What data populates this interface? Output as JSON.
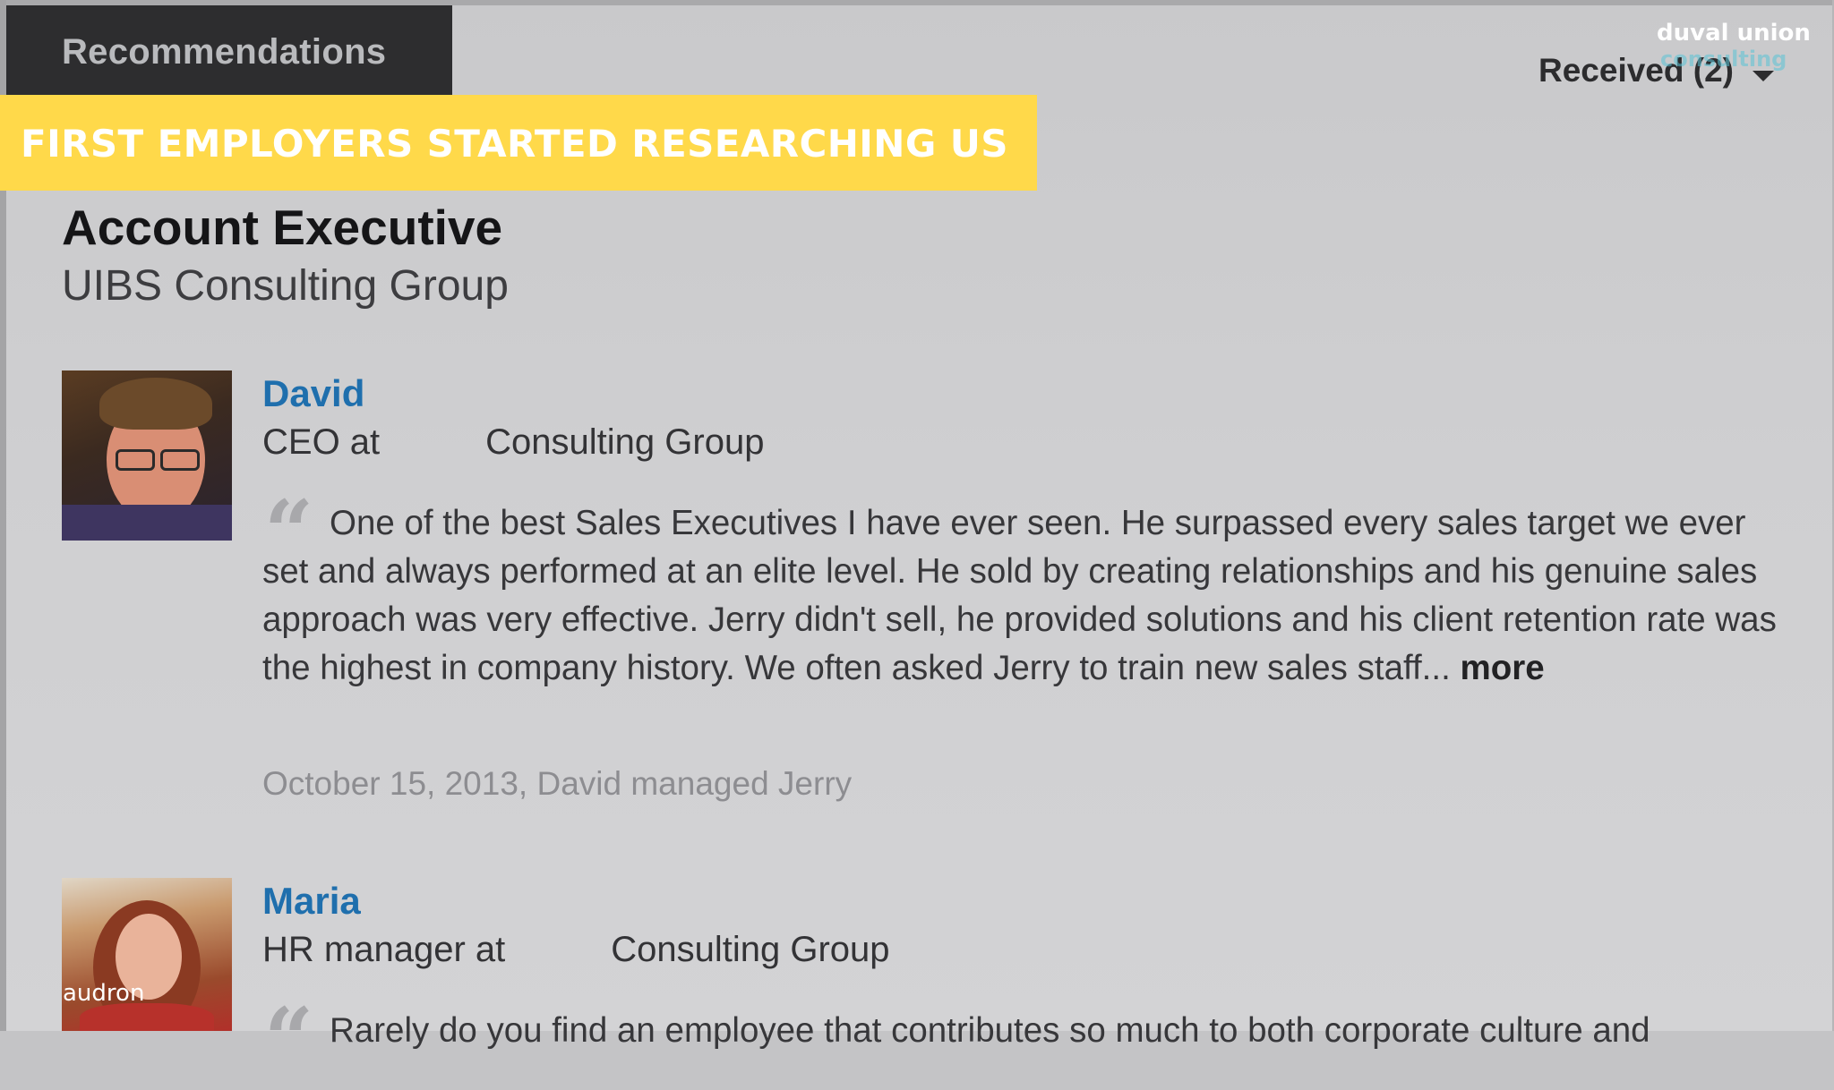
{
  "header": {
    "tab_label": "Recommendations",
    "received_label": "Received (2)"
  },
  "banner": {
    "text": "FIRST EMPLOYERS STARTED RESEARCHING US"
  },
  "logo": {
    "line1": "duval union",
    "line2": "consulting"
  },
  "position": {
    "title": "Account Executive",
    "company": "UIBS Consulting Group"
  },
  "recommendations": [
    {
      "name": "David",
      "role_prefix": "CEO at",
      "role_company": "Consulting Group",
      "text": "One of the best Sales Executives I have ever seen. He surpassed every sales target we ever set and always performed at an elite level. He sold by creating relationships and his genuine sales approach was very effective. Jerry didn't sell, he provided solutions and his client retention rate was the highest in company history. We often asked Jerry to train new sales staff...",
      "more_label": "more",
      "meta": "October 15, 2013, David managed Jerry"
    },
    {
      "name": "Maria",
      "role_prefix": "HR manager at",
      "role_company": "Consulting Group",
      "text": "Rarely do you find an employee that contributes so much to both corporate culture and"
    }
  ],
  "caption": {
    "text": "audron"
  },
  "colors": {
    "banner": "#ffd94a",
    "name_link": "#1f6fad",
    "tab_bg": "#2d2d2f"
  }
}
